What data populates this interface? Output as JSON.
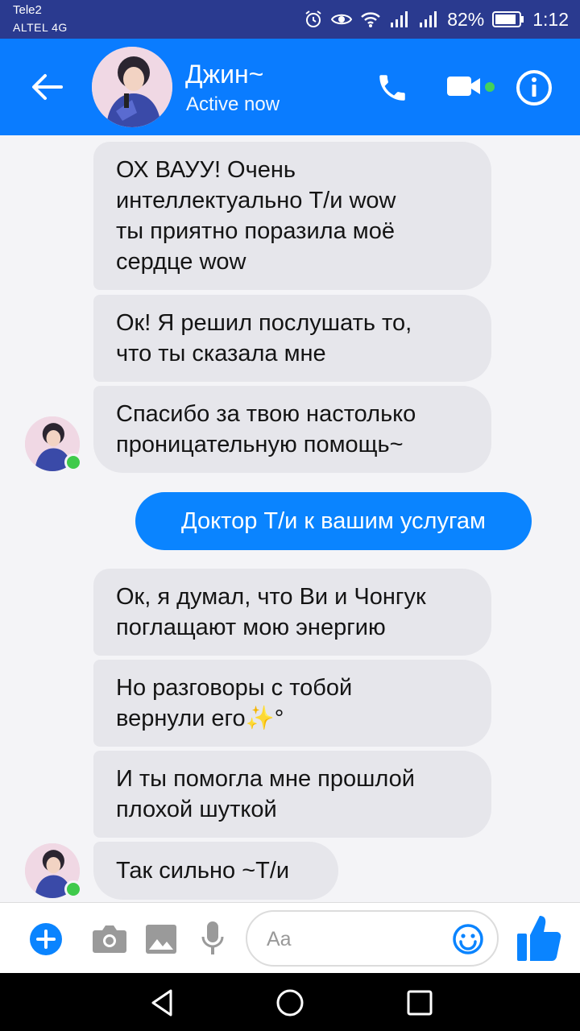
{
  "status_bar": {
    "carrier_1": "Tele2",
    "carrier_2": "ALTEL 4G",
    "battery_percent": "82%",
    "time": "1:12"
  },
  "header": {
    "contact_name": "Джин~",
    "contact_status": "Active now"
  },
  "messages": [
    {
      "direction": "in",
      "text": "ОХ   ВАУУ! Очень\nинтеллектуально Т/и wow\nты приятно поразила моё\nсердце wow"
    },
    {
      "direction": "in",
      "text": "Ок! Я решил послушать то,\nчто ты сказала мне"
    },
    {
      "direction": "in",
      "text": "Спасибо за твою настолько\nпроницательную помощь~"
    },
    {
      "direction": "out",
      "text": "Доктор Т/и к вашим услугам"
    },
    {
      "direction": "in",
      "text": "Ок, я думал, что Ви и Чонгук\nпоглащают мою энергию"
    },
    {
      "direction": "in",
      "text": "Но разговоры с тобой\nвернули его✨°"
    },
    {
      "direction": "in",
      "text": "И ты помогла мне прошлой\nплохой шуткой"
    },
    {
      "direction": "in",
      "text": "Так сильно ~Т/и"
    }
  ],
  "composer": {
    "placeholder": "Aa"
  },
  "colors": {
    "header_blue": "#0a7cff",
    "status_bar": "#2a3a8f",
    "incoming_bubble": "#e6e6eb",
    "outgoing_bubble": "#0a84ff",
    "online_green": "#3fca4b"
  }
}
